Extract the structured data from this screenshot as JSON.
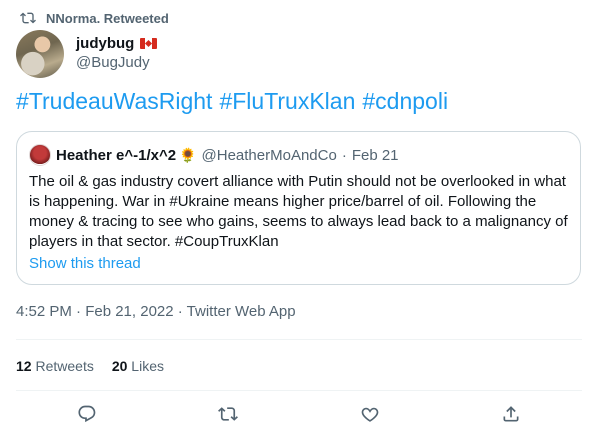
{
  "retweet": {
    "label": "NNorma. Retweeted",
    "icon": "retweet-icon"
  },
  "author": {
    "display_name": "judybug",
    "handle": "@BugJudy",
    "flag": "canada-flag-icon"
  },
  "hashtags": [
    "#TrudeauWasRight",
    "#FluTruxKlan",
    "#cdnpoli"
  ],
  "quote": {
    "name": "Heather e^-1/x^2",
    "emoji": "🌻",
    "handle": "@HeatherMoAndCo",
    "separator": "·",
    "date": "Feb 21",
    "body": "The oil & gas industry covert alliance with Putin should not be overlooked in what is happening. War in #Ukraine means higher price/barrel of oil. Following the money & tracing to see who gains, seems to always lead back to a malignancy of players in that sector. #CoupTruxKlan",
    "show_thread": "Show this thread"
  },
  "timestamp": "4:52 PM · Feb 21, 2022 · Twitter Web App",
  "stats": {
    "retweets_count": "12",
    "retweets_label": "Retweets",
    "likes_count": "20",
    "likes_label": "Likes"
  },
  "actions": [
    "reply-icon",
    "retweet-icon",
    "like-icon",
    "share-icon"
  ],
  "colors": {
    "link": "#1d9bf0",
    "secondary_text": "#536471",
    "border": "#cfd9de"
  }
}
